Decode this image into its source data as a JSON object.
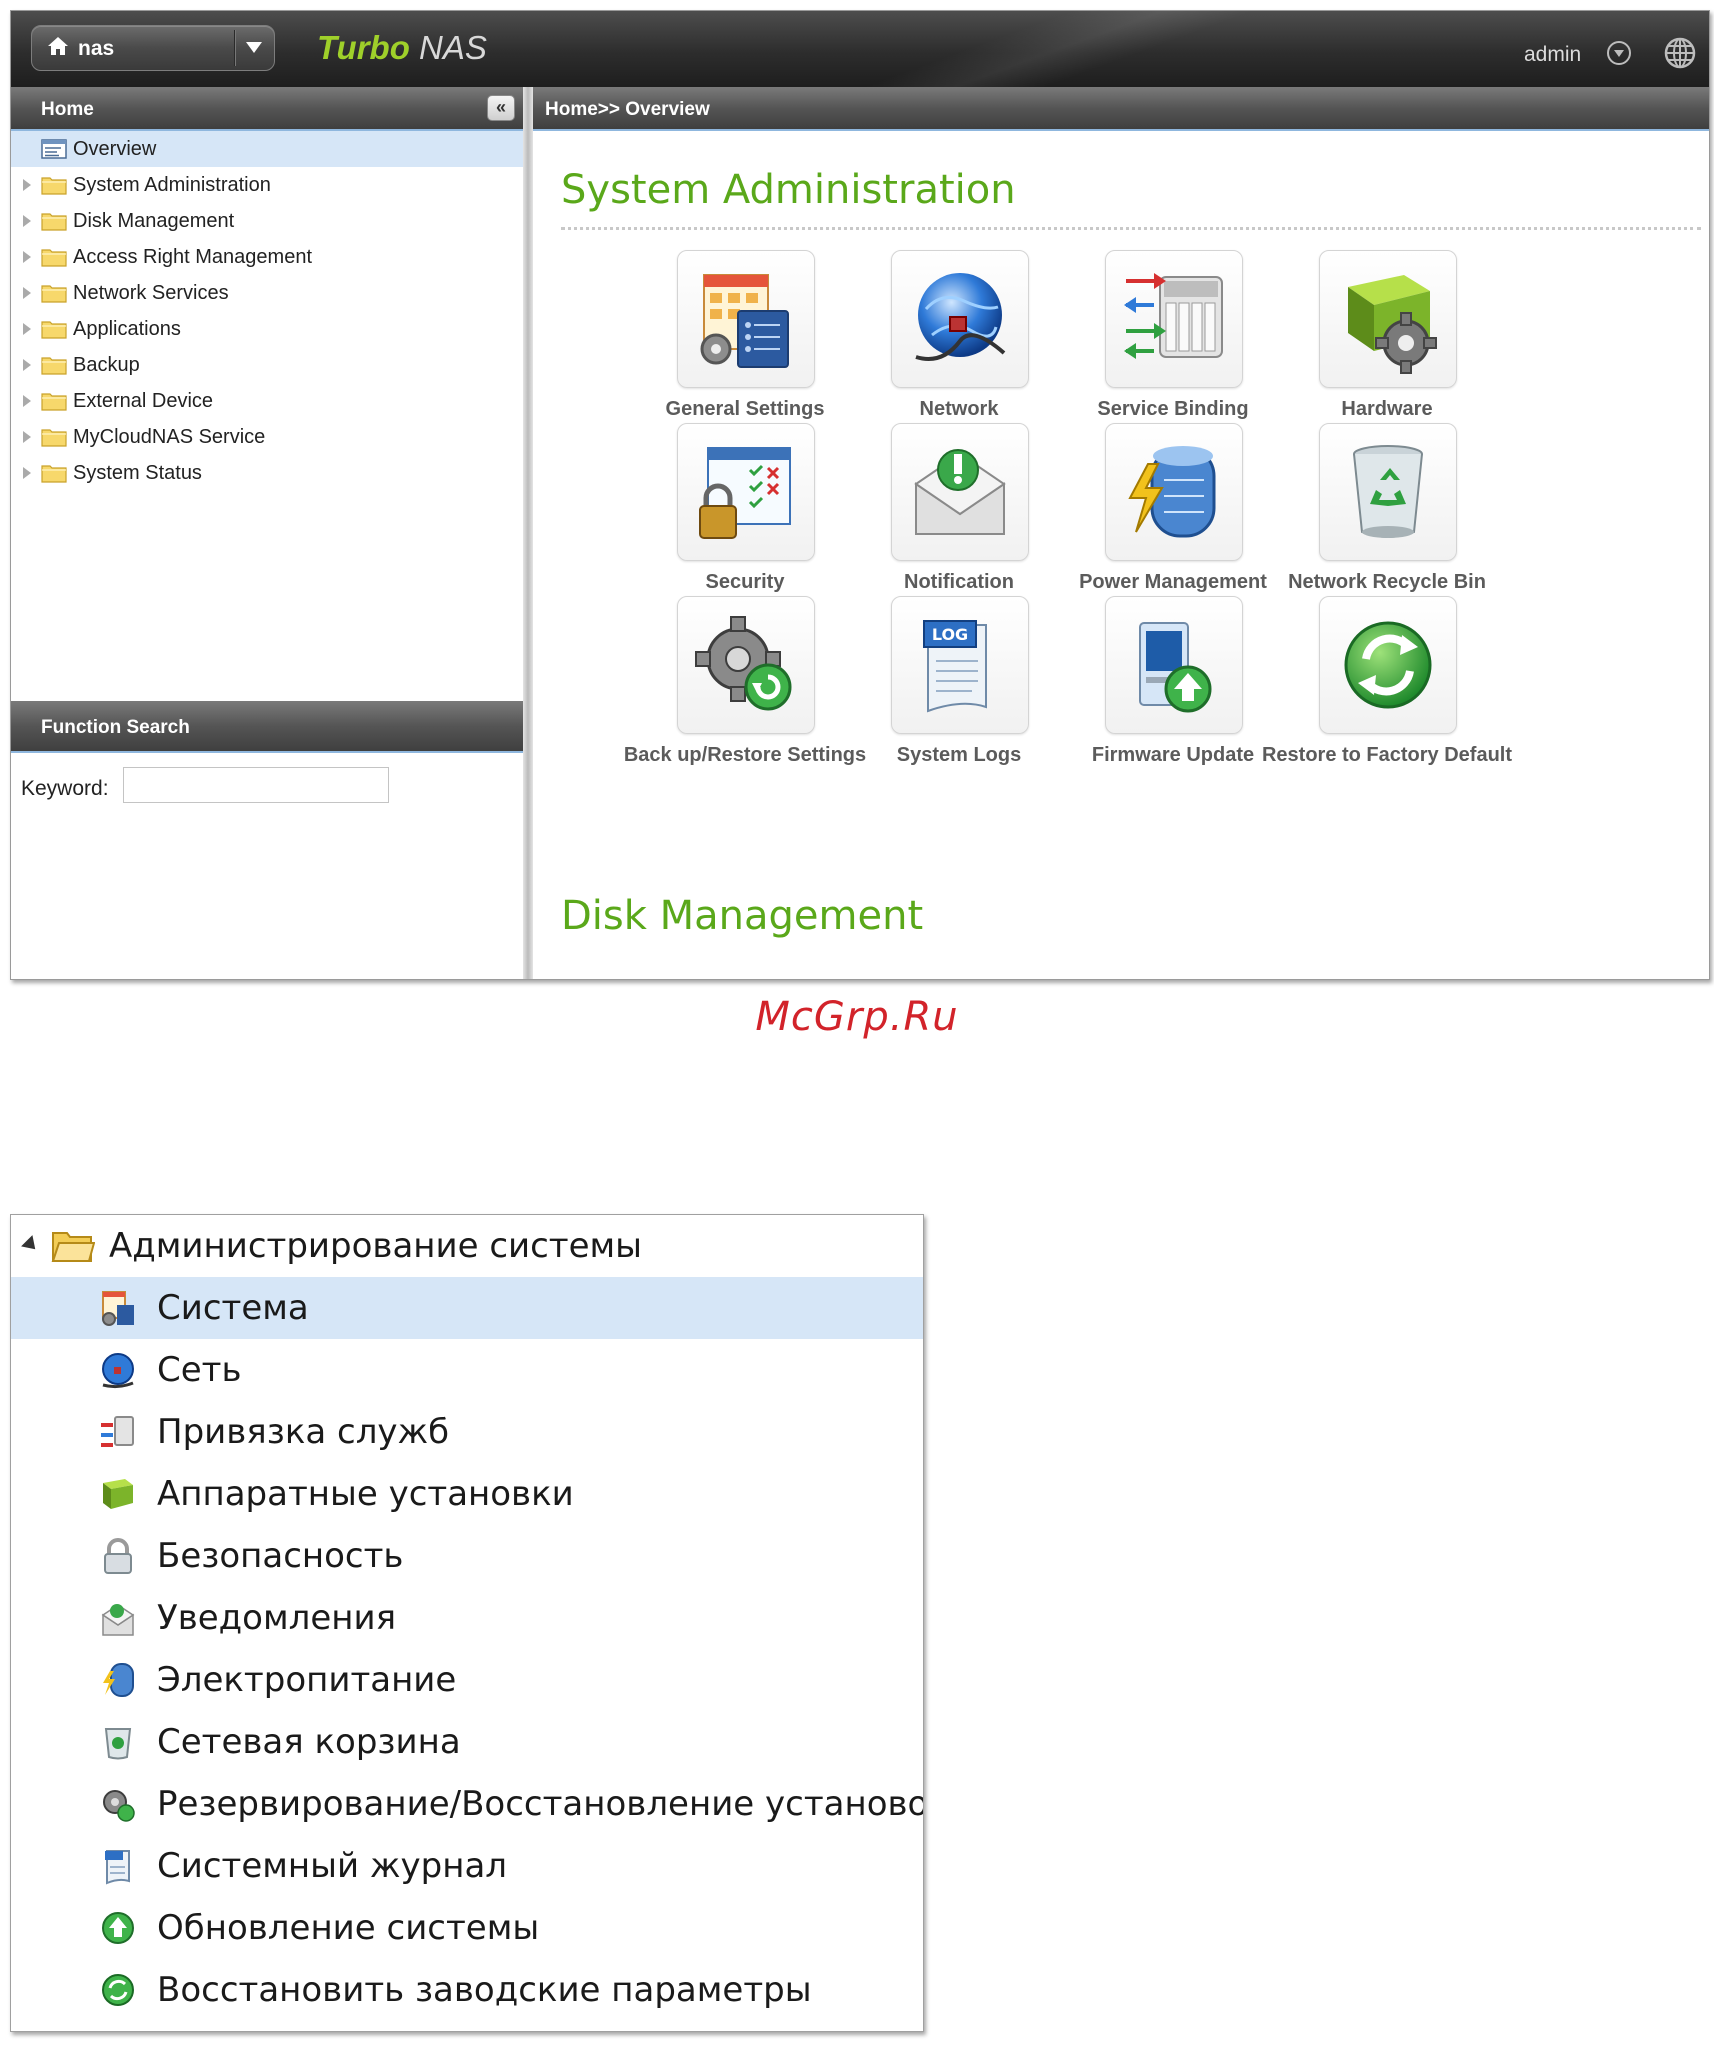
{
  "header": {
    "host": "nas",
    "brand_bold": "Turbo",
    "brand_rest": " NAS",
    "user": "admin"
  },
  "sidebar": {
    "title": "Home",
    "collapse_glyph": "«",
    "items": [
      {
        "label": "Overview",
        "icon": "overview-icon",
        "selected": true
      },
      {
        "label": "System Administration",
        "icon": "folder-icon"
      },
      {
        "label": "Disk Management",
        "icon": "folder-icon"
      },
      {
        "label": "Access Right Management",
        "icon": "folder-icon"
      },
      {
        "label": "Network Services",
        "icon": "folder-icon"
      },
      {
        "label": "Applications",
        "icon": "folder-icon"
      },
      {
        "label": "Backup",
        "icon": "folder-icon"
      },
      {
        "label": "External Device",
        "icon": "folder-icon"
      },
      {
        "label": "MyCloudNAS Service",
        "icon": "folder-icon"
      },
      {
        "label": "System Status",
        "icon": "folder-icon"
      }
    ]
  },
  "function_search": {
    "title": "Function Search",
    "keyword_label": "Keyword:",
    "keyword_value": ""
  },
  "main": {
    "breadcrumb": "Home>> Overview",
    "section1_title": "System Administration",
    "section2_title": "Disk Management",
    "tiles": [
      {
        "label": "General Settings",
        "icon": "general-settings-icon"
      },
      {
        "label": "Network",
        "icon": "network-globe-icon"
      },
      {
        "label": "Service Binding",
        "icon": "service-binding-icon"
      },
      {
        "label": "Hardware",
        "icon": "hardware-gear-icon"
      },
      {
        "label": "Security",
        "icon": "security-lock-icon"
      },
      {
        "label": "Notification",
        "icon": "notification-envelope-icon"
      },
      {
        "label": "Power Management",
        "icon": "power-management-icon"
      },
      {
        "label": "Network Recycle Bin",
        "icon": "recycle-bin-icon"
      },
      {
        "label": "Back up/Restore Settings",
        "icon": "backup-restore-gear-icon"
      },
      {
        "label": "System Logs",
        "icon": "system-logs-icon"
      },
      {
        "label": "Firmware Update",
        "icon": "firmware-update-icon"
      },
      {
        "label": "Restore to Factory Default",
        "icon": "factory-default-icon"
      }
    ]
  },
  "watermark": "McGrp.Ru",
  "ru_tree": {
    "root": "Администрирование системы",
    "items": [
      {
        "label": "Система",
        "icon": "general-settings-icon",
        "selected": true
      },
      {
        "label": "Сеть",
        "icon": "network-globe-icon"
      },
      {
        "label": "Привязка служб",
        "icon": "service-binding-icon"
      },
      {
        "label": "Аппаратные установки",
        "icon": "hardware-gear-icon"
      },
      {
        "label": "Безопасность",
        "icon": "security-lock-icon"
      },
      {
        "label": "Уведомления",
        "icon": "notification-envelope-icon"
      },
      {
        "label": "Электропитание",
        "icon": "power-management-icon"
      },
      {
        "label": "Сетевая корзина",
        "icon": "recycle-bin-icon"
      },
      {
        "label": "Резервирование/Восстановление установок",
        "icon": "backup-restore-gear-icon"
      },
      {
        "label": "Системный журнал",
        "icon": "system-logs-icon"
      },
      {
        "label": "Обновление системы",
        "icon": "firmware-update-icon"
      },
      {
        "label": "Восстановить заводские параметры",
        "icon": "factory-default-icon"
      }
    ]
  },
  "colors": {
    "accent_green": "#5aa81a",
    "brand_green": "#9fd02a",
    "selection_blue": "#d6e6f7",
    "watermark_red": "#d2232a"
  }
}
